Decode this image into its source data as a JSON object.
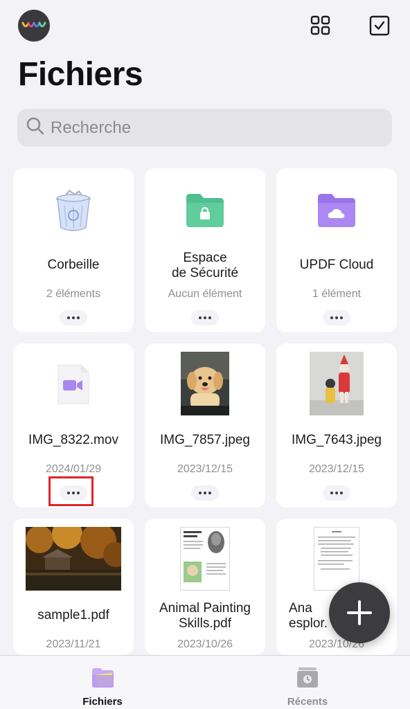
{
  "header": {
    "avatar_icon": "app-logo-icon",
    "grid_icon": "grid-view-icon",
    "select_icon": "checkbox-select-icon",
    "title": "Fichiers"
  },
  "search": {
    "placeholder": "Recherche",
    "value": ""
  },
  "folders": [
    {
      "name": "Corbeille",
      "meta": "2 éléments",
      "icon": "trash-icon"
    },
    {
      "name": "Espace\nde Sécurité",
      "meta": "Aucun élément",
      "icon": "secure-folder-icon"
    },
    {
      "name": "UPDF Cloud",
      "meta": "1 élément",
      "icon": "cloud-folder-icon"
    }
  ],
  "files": [
    {
      "name": "IMG_8322.mov",
      "date": "2024/01/29",
      "icon": "video-file-icon"
    },
    {
      "name": "IMG_7857.jpeg",
      "date": "2023/12/15",
      "icon": "puppy-photo-thumbnail"
    },
    {
      "name": "IMG_7643.jpeg",
      "date": "2023/12/15",
      "icon": "toys-photo-thumbnail"
    },
    {
      "name": "sample1.pdf",
      "date": "2023/11/21",
      "icon": "autumn-photo-thumbnail"
    },
    {
      "name": "Animal Painting\nSkills.pdf",
      "date": "2023/10/26",
      "icon": "pdf-page-thumbnail"
    },
    {
      "name": "Ana\nesplor.",
      "date": "2023/10/26",
      "icon": "pdf-page-thumbnail"
    }
  ],
  "fab": {
    "icon": "plus-icon"
  },
  "tabbar": {
    "tabs": [
      {
        "label": "Fichiers",
        "active": true,
        "color": "#111111"
      },
      {
        "label": "Récents",
        "active": false,
        "color": "#8e8e93"
      }
    ]
  },
  "colors": {
    "accent_highlight": "#e0252a",
    "folder_green": "#4fbf8f",
    "folder_purple": "#a07cf0"
  }
}
